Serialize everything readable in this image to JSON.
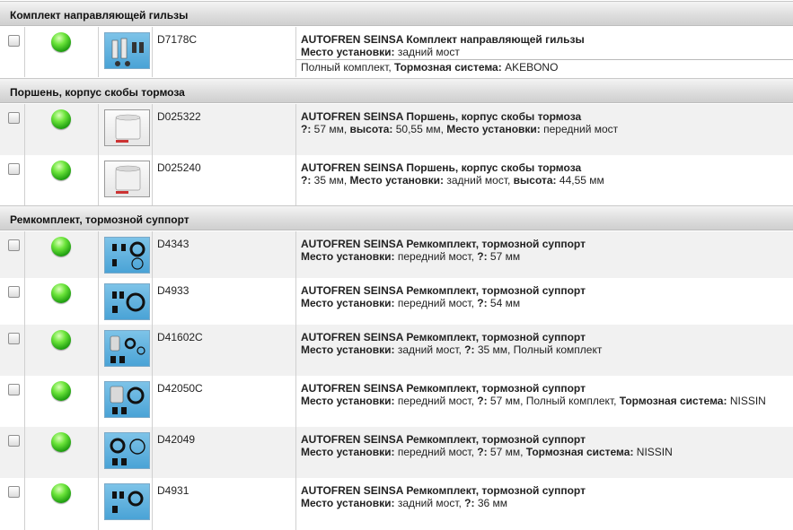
{
  "groups": [
    {
      "title": "Комплект направляющей гильзы",
      "items": [
        {
          "code": "D7178C",
          "thumb": "guide-sleeve-kit",
          "title": "AUTOFREN SEINSA Комплект направляющей гильзы",
          "line1": [
            {
              "k": "Место установки:",
              "v": " задний мост"
            }
          ],
          "line2": [
            {
              "k": "",
              "v": "Полный комплект, "
            },
            {
              "k": "Тормозная система:",
              "v": " AKEBONO"
            }
          ]
        }
      ]
    },
    {
      "title": "Поршень, корпус скобы тормоза",
      "items": [
        {
          "code": "D025322",
          "thumb": "piston",
          "title": "AUTOFREN SEINSA Поршень, корпус скобы тормоза",
          "line1": [
            {
              "k": "?:",
              "v": " 57 мм, "
            },
            {
              "k": "высота:",
              "v": " 50,55 мм, "
            },
            {
              "k": "Место установки:",
              "v": " передний мост"
            }
          ]
        },
        {
          "code": "D025240",
          "thumb": "piston",
          "title": "AUTOFREN SEINSA Поршень, корпус скобы тормоза",
          "line1": [
            {
              "k": "?:",
              "v": " 35 мм, "
            },
            {
              "k": "Место установки:",
              "v": " задний мост, "
            },
            {
              "k": "высота:",
              "v": " 44,55 мм"
            }
          ]
        }
      ]
    },
    {
      "title": "Ремкомплект, тормозной суппорт",
      "items": [
        {
          "code": "D4343",
          "thumb": "repair-kit",
          "title": "AUTOFREN SEINSA Ремкомплект, тормозной суппорт",
          "line1": [
            {
              "k": "Место установки:",
              "v": " передний мост, "
            },
            {
              "k": "?:",
              "v": " 57 мм"
            }
          ]
        },
        {
          "code": "D4933",
          "thumb": "repair-kit",
          "title": "AUTOFREN SEINSA Ремкомплект, тормозной суппорт",
          "line1": [
            {
              "k": "Место установки:",
              "v": " передний мост, "
            },
            {
              "k": "?:",
              "v": " 54 мм"
            }
          ]
        },
        {
          "code": "D41602C",
          "thumb": "repair-kit-full",
          "title": "AUTOFREN SEINSA Ремкомплект, тормозной суппорт",
          "line1": [
            {
              "k": "Место установки:",
              "v": " задний мост, "
            },
            {
              "k": "?:",
              "v": " 35 мм, Полный комплект"
            }
          ]
        },
        {
          "code": "D42050C",
          "thumb": "repair-kit-full",
          "title": "AUTOFREN SEINSA Ремкомплект, тормозной суппорт",
          "line1": [
            {
              "k": "Место установки:",
              "v": " передний мост, "
            },
            {
              "k": "?:",
              "v": " 57 мм, Полный комплект, "
            },
            {
              "k": "Тормозная система:",
              "v": " NISSIN"
            }
          ]
        },
        {
          "code": "D42049",
          "thumb": "repair-kit",
          "title": "AUTOFREN SEINSA Ремкомплект, тормозной суппорт",
          "line1": [
            {
              "k": "Место установки:",
              "v": " передний мост, "
            },
            {
              "k": "?:",
              "v": " 57 мм, "
            },
            {
              "k": "Тормозная система:",
              "v": " NISSIN"
            }
          ]
        },
        {
          "code": "D4931",
          "thumb": "repair-kit",
          "title": "AUTOFREN SEINSA Ремкомплект, тормозной суппорт",
          "line1": [
            {
              "k": "Место установки:",
              "v": " задний мост, "
            },
            {
              "k": "?:",
              "v": " 36 мм"
            }
          ]
        }
      ]
    }
  ],
  "colors": {
    "status_available": "#2fbf1a",
    "header_bg": "#dcdcdc"
  }
}
